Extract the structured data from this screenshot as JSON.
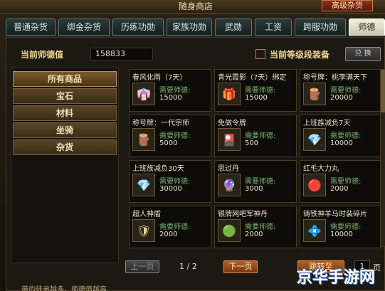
{
  "window": {
    "title": "随身商店",
    "top_button": "高级杂货"
  },
  "tabs": [
    {
      "label": "普通杂货"
    },
    {
      "label": "绑金杂货"
    },
    {
      "label": "历练功勋"
    },
    {
      "label": "家族功勋"
    },
    {
      "label": "武勋"
    },
    {
      "label": "工资"
    },
    {
      "label": "跨服功勋"
    },
    {
      "label": "师德"
    }
  ],
  "header": {
    "virtue_label": "当前师德值",
    "virtue_value": "158833",
    "equip_checkbox_label": "当前等级段装备",
    "confirm_button": "兑 换"
  },
  "categories": [
    {
      "label": "所有商品"
    },
    {
      "label": "宝石"
    },
    {
      "label": "材料"
    },
    {
      "label": "坐骑"
    },
    {
      "label": "杂货"
    }
  ],
  "items": [
    {
      "name": "春风化雨（7天）",
      "need": "需要师德:",
      "price": "15000",
      "icon": "robe-icon",
      "glyph": "👘"
    },
    {
      "name": "青光霞影（7天）绑定",
      "need": "需要师德:",
      "price": "15000",
      "icon": "gift-box-icon",
      "glyph": "🎁"
    },
    {
      "name": "称号牌：桃李满天下",
      "need": "需要师德:",
      "price": "20000",
      "icon": "title-plaque-icon",
      "glyph": "🪵"
    },
    {
      "name": "称号牌：一代宗师",
      "need": "需要师德:",
      "price": "5000",
      "icon": "title-plaque-icon",
      "glyph": "🪵"
    },
    {
      "name": "免做令牌",
      "need": "需要师德:",
      "price": "500",
      "icon": "token-card-icon",
      "glyph": "🎴"
    },
    {
      "name": "上班族减负7天",
      "need": "需要师德:",
      "price": "10000",
      "icon": "crystal-wings-icon",
      "glyph": "💎"
    },
    {
      "name": "上班族减负30天",
      "need": "需要师德:",
      "price": "30000",
      "icon": "crystal-wings-icon",
      "glyph": "💎"
    },
    {
      "name": "思过丹",
      "need": "需要师德:",
      "price": "3000",
      "icon": "purple-orb-icon",
      "glyph": "🔮"
    },
    {
      "name": "红毛大力丸",
      "need": "需要师德:",
      "price": "2000",
      "icon": "red-pill-icon",
      "glyph": "🔴"
    },
    {
      "name": "超人神盾",
      "need": "需要师德:",
      "price": "2000",
      "icon": "shield-icon",
      "glyph": "🛡"
    },
    {
      "name": "银牌网吧军神丹",
      "need": "需要师德:",
      "price": "2000",
      "icon": "green-orb-icon",
      "glyph": "🟢"
    },
    {
      "name": "铸铁神羊马时装碎片",
      "need": "需要师德:",
      "price": "10000",
      "icon": "crystal-shard-icon",
      "glyph": "💠"
    }
  ],
  "pager": {
    "prev_label": "上一页",
    "page_info": "1 / 2",
    "next_label": "下一页",
    "jump_label": "跳转至",
    "page_input": "1",
    "page_suffix": "页"
  },
  "footer": {
    "text": "带的徒弟越多，师德值越高"
  },
  "watermark": {
    "text": "京华手游网"
  },
  "colors": {
    "accent_gold": "#f0d890",
    "need_green": "#7ab070",
    "next_orange": "#b06020"
  }
}
